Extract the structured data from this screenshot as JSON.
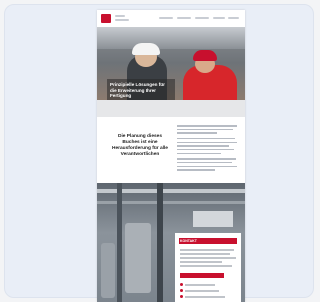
{
  "hero": {
    "caption": "Prinzipielle Lösungen für die Erweiterung Ihrer Fertigung"
  },
  "section": {
    "headline": "Die Planung dieses Buches ist eine Herausforderung für alle Verantwortlichen"
  },
  "box": {
    "title": "KONTAKT"
  },
  "colors": {
    "brand": "#c8102e",
    "card_background": "#e9eef7"
  }
}
